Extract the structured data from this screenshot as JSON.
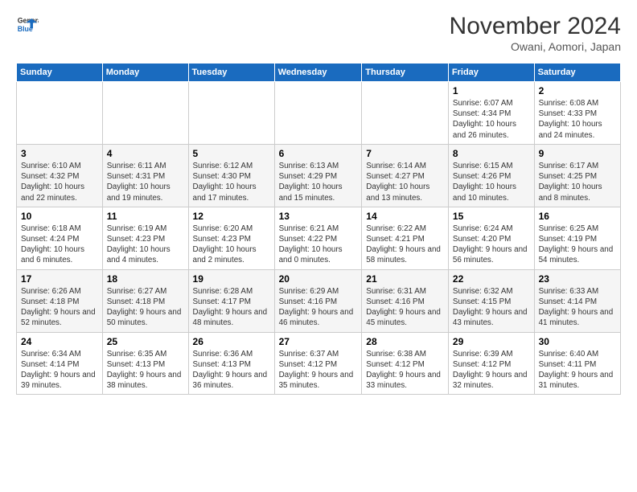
{
  "logo": {
    "text1": "General",
    "text2": "Blue"
  },
  "title": "November 2024",
  "location": "Owani, Aomori, Japan",
  "weekdays": [
    "Sunday",
    "Monday",
    "Tuesday",
    "Wednesday",
    "Thursday",
    "Friday",
    "Saturday"
  ],
  "weeks": [
    [
      {
        "day": "",
        "info": ""
      },
      {
        "day": "",
        "info": ""
      },
      {
        "day": "",
        "info": ""
      },
      {
        "day": "",
        "info": ""
      },
      {
        "day": "",
        "info": ""
      },
      {
        "day": "1",
        "info": "Sunrise: 6:07 AM\nSunset: 4:34 PM\nDaylight: 10 hours and 26 minutes."
      },
      {
        "day": "2",
        "info": "Sunrise: 6:08 AM\nSunset: 4:33 PM\nDaylight: 10 hours and 24 minutes."
      }
    ],
    [
      {
        "day": "3",
        "info": "Sunrise: 6:10 AM\nSunset: 4:32 PM\nDaylight: 10 hours and 22 minutes."
      },
      {
        "day": "4",
        "info": "Sunrise: 6:11 AM\nSunset: 4:31 PM\nDaylight: 10 hours and 19 minutes."
      },
      {
        "day": "5",
        "info": "Sunrise: 6:12 AM\nSunset: 4:30 PM\nDaylight: 10 hours and 17 minutes."
      },
      {
        "day": "6",
        "info": "Sunrise: 6:13 AM\nSunset: 4:29 PM\nDaylight: 10 hours and 15 minutes."
      },
      {
        "day": "7",
        "info": "Sunrise: 6:14 AM\nSunset: 4:27 PM\nDaylight: 10 hours and 13 minutes."
      },
      {
        "day": "8",
        "info": "Sunrise: 6:15 AM\nSunset: 4:26 PM\nDaylight: 10 hours and 10 minutes."
      },
      {
        "day": "9",
        "info": "Sunrise: 6:17 AM\nSunset: 4:25 PM\nDaylight: 10 hours and 8 minutes."
      }
    ],
    [
      {
        "day": "10",
        "info": "Sunrise: 6:18 AM\nSunset: 4:24 PM\nDaylight: 10 hours and 6 minutes."
      },
      {
        "day": "11",
        "info": "Sunrise: 6:19 AM\nSunset: 4:23 PM\nDaylight: 10 hours and 4 minutes."
      },
      {
        "day": "12",
        "info": "Sunrise: 6:20 AM\nSunset: 4:23 PM\nDaylight: 10 hours and 2 minutes."
      },
      {
        "day": "13",
        "info": "Sunrise: 6:21 AM\nSunset: 4:22 PM\nDaylight: 10 hours and 0 minutes."
      },
      {
        "day": "14",
        "info": "Sunrise: 6:22 AM\nSunset: 4:21 PM\nDaylight: 9 hours and 58 minutes."
      },
      {
        "day": "15",
        "info": "Sunrise: 6:24 AM\nSunset: 4:20 PM\nDaylight: 9 hours and 56 minutes."
      },
      {
        "day": "16",
        "info": "Sunrise: 6:25 AM\nSunset: 4:19 PM\nDaylight: 9 hours and 54 minutes."
      }
    ],
    [
      {
        "day": "17",
        "info": "Sunrise: 6:26 AM\nSunset: 4:18 PM\nDaylight: 9 hours and 52 minutes."
      },
      {
        "day": "18",
        "info": "Sunrise: 6:27 AM\nSunset: 4:18 PM\nDaylight: 9 hours and 50 minutes."
      },
      {
        "day": "19",
        "info": "Sunrise: 6:28 AM\nSunset: 4:17 PM\nDaylight: 9 hours and 48 minutes."
      },
      {
        "day": "20",
        "info": "Sunrise: 6:29 AM\nSunset: 4:16 PM\nDaylight: 9 hours and 46 minutes."
      },
      {
        "day": "21",
        "info": "Sunrise: 6:31 AM\nSunset: 4:16 PM\nDaylight: 9 hours and 45 minutes."
      },
      {
        "day": "22",
        "info": "Sunrise: 6:32 AM\nSunset: 4:15 PM\nDaylight: 9 hours and 43 minutes."
      },
      {
        "day": "23",
        "info": "Sunrise: 6:33 AM\nSunset: 4:14 PM\nDaylight: 9 hours and 41 minutes."
      }
    ],
    [
      {
        "day": "24",
        "info": "Sunrise: 6:34 AM\nSunset: 4:14 PM\nDaylight: 9 hours and 39 minutes."
      },
      {
        "day": "25",
        "info": "Sunrise: 6:35 AM\nSunset: 4:13 PM\nDaylight: 9 hours and 38 minutes."
      },
      {
        "day": "26",
        "info": "Sunrise: 6:36 AM\nSunset: 4:13 PM\nDaylight: 9 hours and 36 minutes."
      },
      {
        "day": "27",
        "info": "Sunrise: 6:37 AM\nSunset: 4:12 PM\nDaylight: 9 hours and 35 minutes."
      },
      {
        "day": "28",
        "info": "Sunrise: 6:38 AM\nSunset: 4:12 PM\nDaylight: 9 hours and 33 minutes."
      },
      {
        "day": "29",
        "info": "Sunrise: 6:39 AM\nSunset: 4:12 PM\nDaylight: 9 hours and 32 minutes."
      },
      {
        "day": "30",
        "info": "Sunrise: 6:40 AM\nSunset: 4:11 PM\nDaylight: 9 hours and 31 minutes."
      }
    ]
  ]
}
